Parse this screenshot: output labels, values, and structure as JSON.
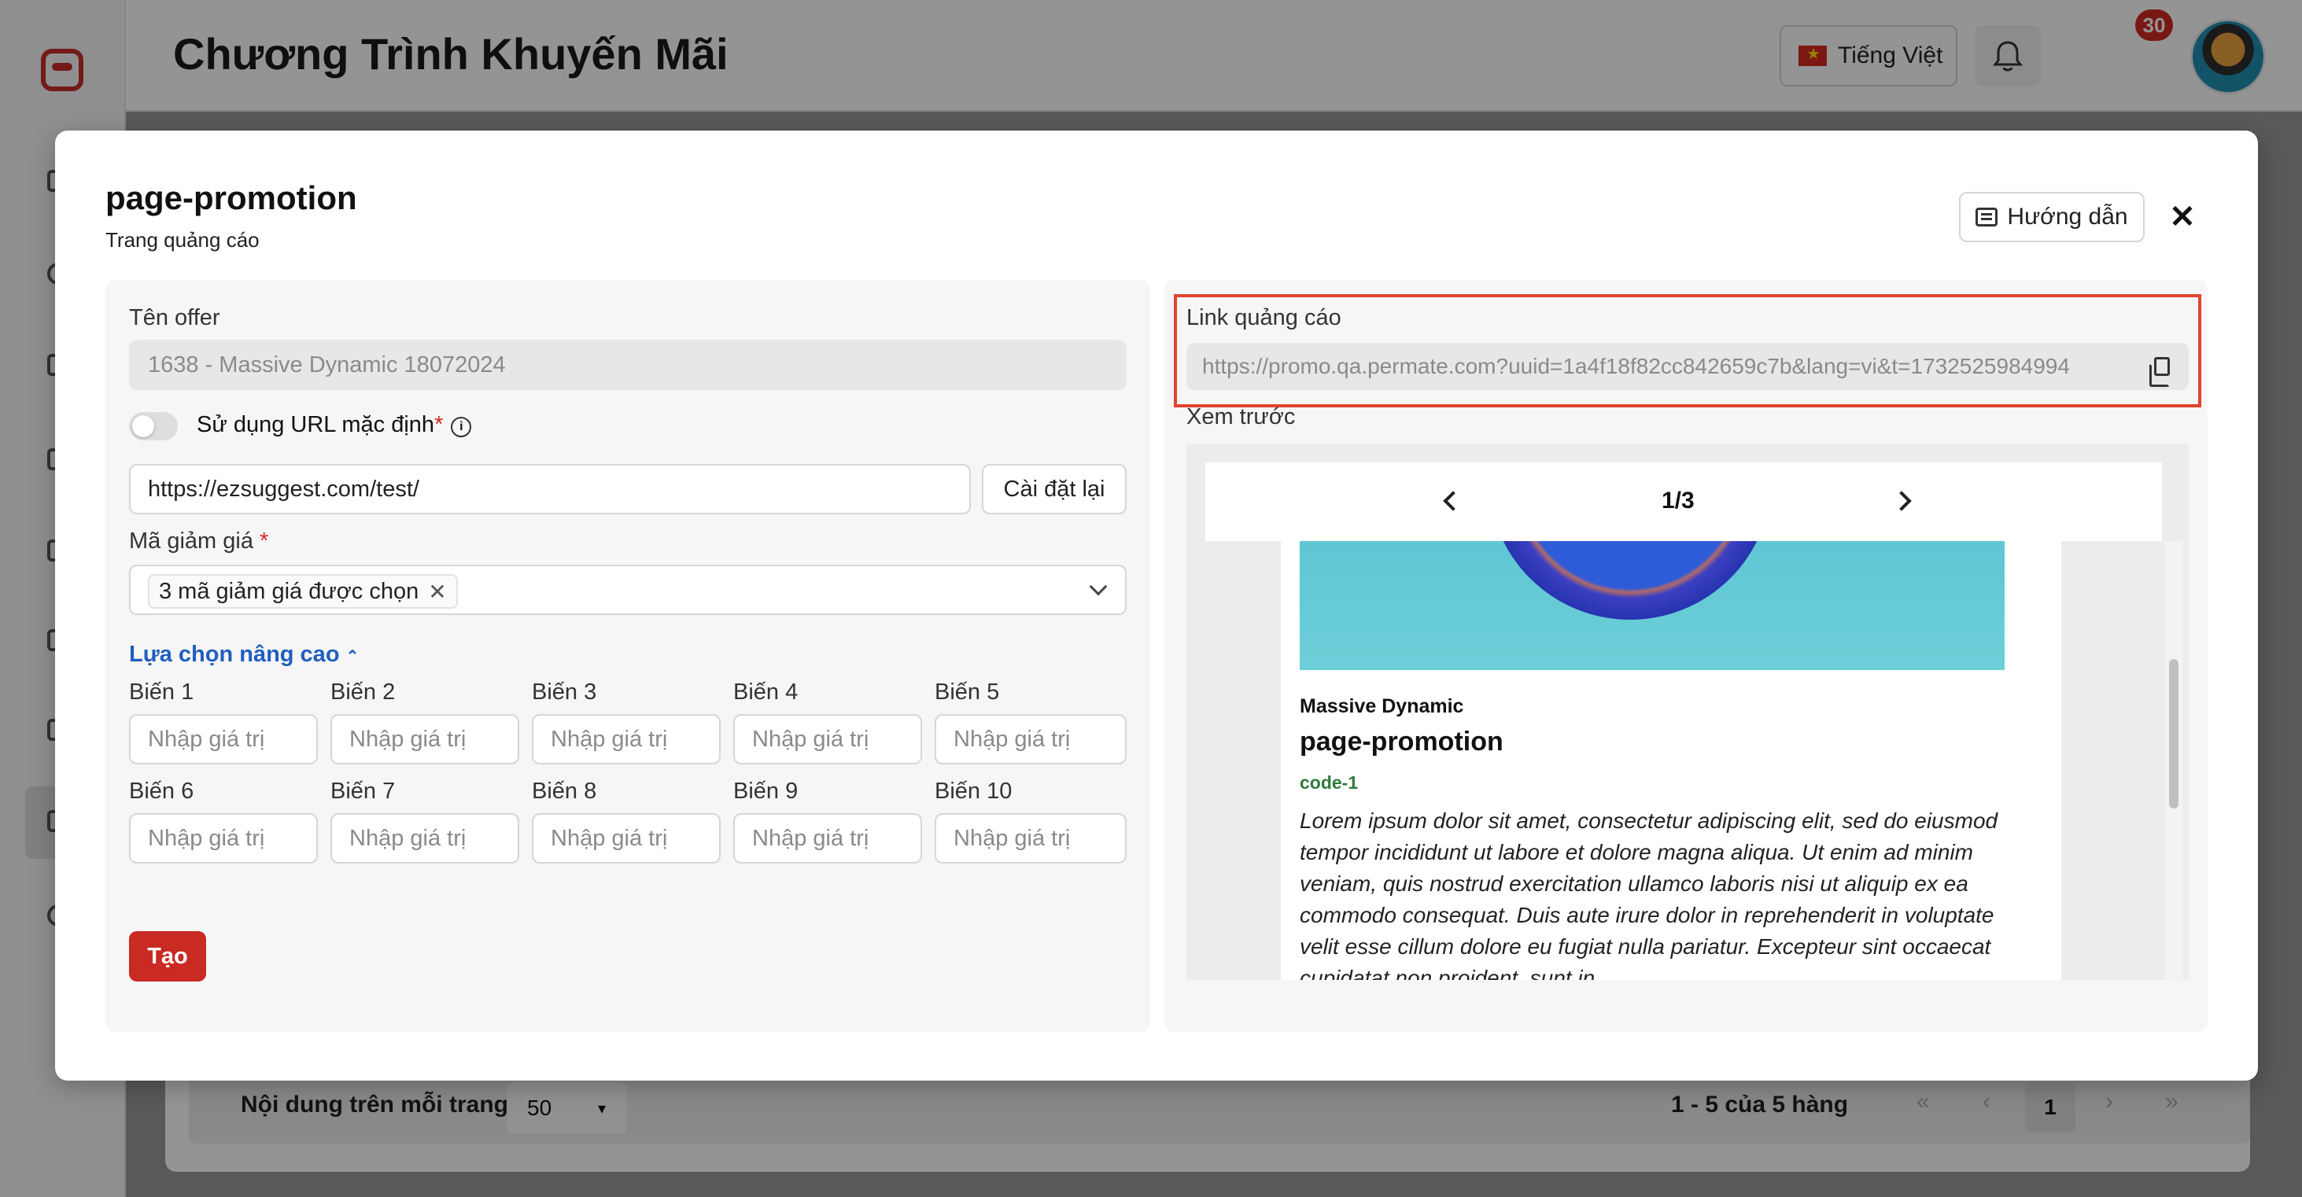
{
  "app": {
    "title": "Chương Trình Khuyến Mãi",
    "language": "Tiếng Việt",
    "notification_count": "30"
  },
  "pagination": {
    "per_page_label": "Nội dung trên mỗi trang:",
    "per_page_value": "50",
    "range_text": "1 - 5 của 5 hàng",
    "current_page": "1",
    "first": "«",
    "prev": "‹",
    "next": "›",
    "last": "»"
  },
  "modal": {
    "title": "page-promotion",
    "subtitle": "Trang quảng cáo",
    "guide_label": "Hướng dẫn",
    "close_symbol": "✕"
  },
  "form": {
    "offer_label": "Tên offer",
    "offer_value": "1638 - Massive Dynamic 18072024",
    "default_url_label": "Sử dụng URL mặc định",
    "required_mark": "*",
    "url_value": "https://ezsuggest.com/test/",
    "reset_label": "Cài đặt lại",
    "coupon_label": "Mã giảm giá",
    "coupon_tag": "3 mã giảm giá được chọn",
    "advanced_label": "Lựa chọn nâng cao",
    "variable_placeholder": "Nhập giá trị",
    "variables": [
      "Biến 1",
      "Biến 2",
      "Biến 3",
      "Biến 4",
      "Biến 5",
      "Biến 6",
      "Biến 7",
      "Biến 8",
      "Biến 9",
      "Biến 10"
    ],
    "create_label": "Tạo"
  },
  "ad_link": {
    "label": "Link quảng cáo",
    "url": "https://promo.qa.permate.com?uuid=1a4f18f82cc842659c7b&lang=vi&t=1732525984994",
    "preview_label": "Xem trước"
  },
  "preview": {
    "slide_counter": "1/3",
    "brand": "Massive Dynamic",
    "title": "page-promotion",
    "code": "code-1",
    "description": "Lorem ipsum dolor sit amet, consectetur adipiscing elit, sed do eiusmod tempor incididunt ut labore et dolore magna aliqua. Ut enim ad minim veniam, quis nostrud exercitation ullamco laboris nisi ut aliquip ex ea commodo consequat. Duis aute irure dolor in reprehenderit in voluptate velit esse cillum dolore eu fugiat nulla pariatur. Excepteur sint occaecat cupidatat non proident, sunt in"
  },
  "colors": {
    "brand_red": "#c92a22",
    "link_blue": "#1f5fbf",
    "highlight_red": "#e0452f",
    "code_green": "#2e7a3d"
  }
}
